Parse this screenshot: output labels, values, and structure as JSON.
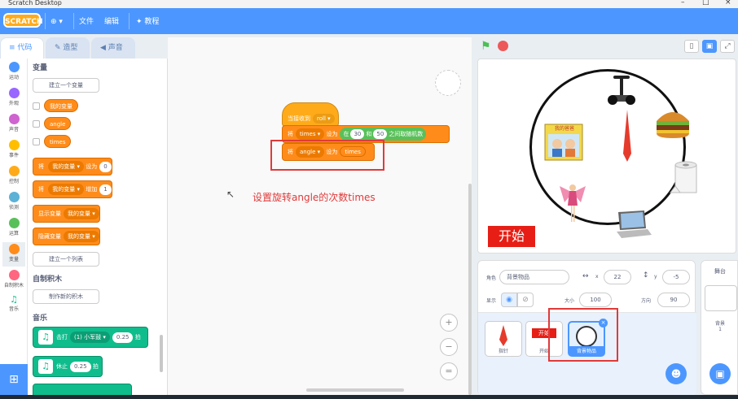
{
  "window": {
    "title": "Scratch Desktop",
    "controls": [
      "–",
      "□",
      "×"
    ]
  },
  "menubar": {
    "logo": "SCRATCH",
    "globe": "⊕ ▾",
    "file": "文件",
    "edit": "编辑",
    "tutorials": "教程"
  },
  "tabs": {
    "code": "代码",
    "costumes": "造型",
    "sounds": "声音"
  },
  "categories": [
    {
      "label": "运动",
      "color": "#4c97ff"
    },
    {
      "label": "外观",
      "color": "#9966ff"
    },
    {
      "label": "声音",
      "color": "#cf63cf"
    },
    {
      "label": "事件",
      "color": "#ffbf00"
    },
    {
      "label": "控制",
      "color": "#ffab19"
    },
    {
      "label": "侦测",
      "color": "#5cb1d6"
    },
    {
      "label": "运算",
      "color": "#59c059"
    },
    {
      "label": "变量",
      "color": "#ff8c1a"
    },
    {
      "label": "自制积木",
      "color": "#ff6680"
    },
    {
      "label": "音乐",
      "color": "#0fbd8c"
    }
  ],
  "palette": {
    "variables_header": "变量",
    "make_variable": "建立一个变量",
    "vars": [
      "我的变量",
      "angle",
      "times"
    ],
    "set_block": {
      "w1": "将",
      "var": "我的变量",
      "w2": "设为",
      "val": "0"
    },
    "change_block": {
      "w1": "将",
      "var": "我的变量",
      "w2": "增加",
      "val": "1"
    },
    "show_block": {
      "w1": "显示变量",
      "var": "我的变量"
    },
    "hide_block": {
      "w1": "隐藏变量",
      "var": "我的变量"
    },
    "make_list": "建立一个列表",
    "myblocks_header": "自制积木",
    "make_block": "制作新的积木",
    "music_header": "音乐",
    "music1": {
      "w1": "击打",
      "drum": "(1) 小军鼓",
      "val": "0.25",
      "w2": "拍"
    },
    "music2": {
      "w1": "休止",
      "val": "0.25",
      "w2": "拍"
    }
  },
  "script": {
    "hat": {
      "w1": "当接收到",
      "msg": "roll"
    },
    "b1": {
      "w1": "将",
      "var": "times",
      "w2": "设为",
      "w3": "在",
      "a": "30",
      "w4": "和",
      "b": "50",
      "w5": "之间取随机数"
    },
    "b2": {
      "w1": "将",
      "var": "angle",
      "w2": "设为",
      "val": "times"
    }
  },
  "annotation": "设置旋转angle的次数times",
  "stage": {
    "start_label": "开始",
    "book_title": "我的爸爸"
  },
  "sprite_info": {
    "sprite_label": "角色",
    "sprite_name": "背景物品",
    "x_label": "x",
    "x_value": "22",
    "y_label": "y",
    "y_value": "-5",
    "show_label": "显示",
    "size_label": "大小",
    "size_value": "100",
    "direction_label": "方向",
    "direction_value": "90"
  },
  "sprites": [
    {
      "name": "指针"
    },
    {
      "name": "开始",
      "badge": "开始"
    },
    {
      "name": "背景物品"
    }
  ],
  "stage_panel": {
    "header": "舞台",
    "bg_label": "背景",
    "bg_count": "1"
  },
  "zoom": {
    "in": "+",
    "out": "−",
    "reset": "="
  }
}
